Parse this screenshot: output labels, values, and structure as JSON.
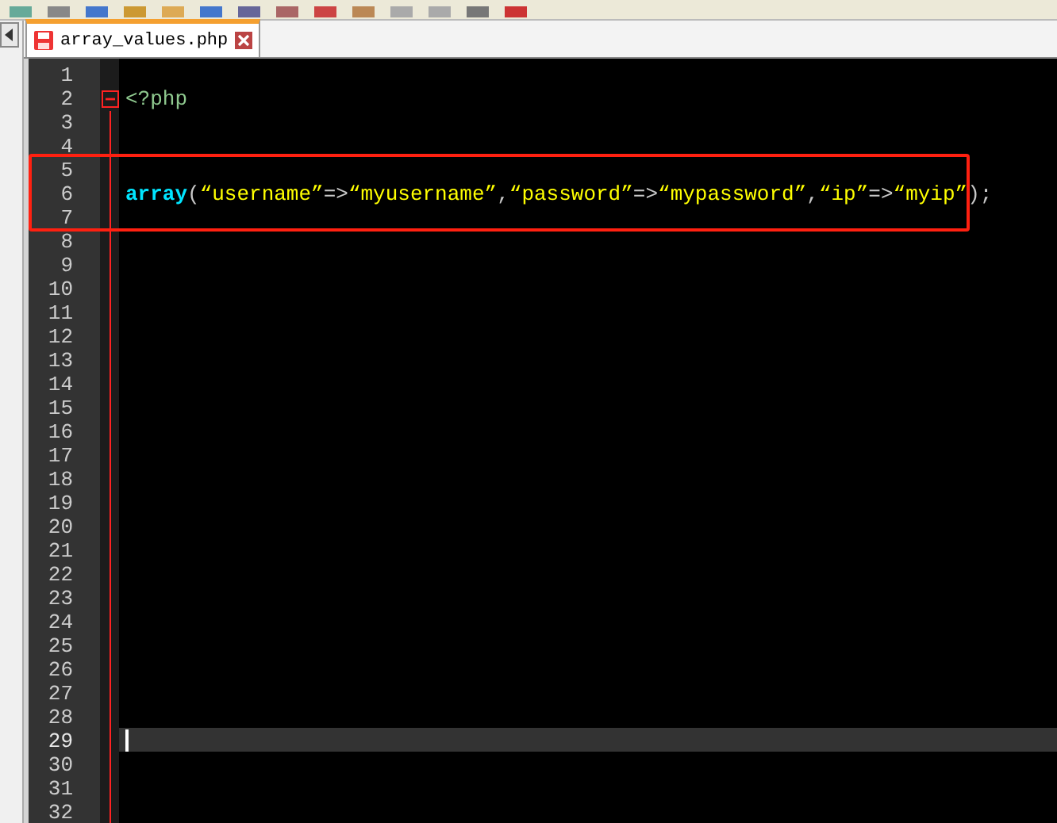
{
  "tabs": [
    {
      "label": "array_values.php",
      "selected": true
    }
  ],
  "editor": {
    "lines": [
      {
        "number": "1",
        "kind": "plain",
        "current": false
      },
      {
        "number": "2",
        "kind": "fold-start",
        "current": false,
        "tokens": [
          {
            "kind": "tag",
            "text": "<?php"
          }
        ]
      },
      {
        "number": "3",
        "kind": "plain",
        "current": false
      },
      {
        "number": "4",
        "kind": "plain",
        "current": false
      },
      {
        "number": "5",
        "kind": "plain",
        "current": false
      },
      {
        "number": "6",
        "kind": "plain",
        "current": false,
        "tokens": [
          {
            "kind": "keyword",
            "text": "array"
          },
          {
            "kind": "punct",
            "text": "("
          },
          {
            "kind": "string",
            "text": "“username”"
          },
          {
            "kind": "punct",
            "text": "=>"
          },
          {
            "kind": "string",
            "text": "“myusername”"
          },
          {
            "kind": "punct",
            "text": ","
          },
          {
            "kind": "string",
            "text": "“password”"
          },
          {
            "kind": "punct",
            "text": "=>"
          },
          {
            "kind": "string",
            "text": "“mypassword”"
          },
          {
            "kind": "punct",
            "text": ","
          },
          {
            "kind": "string",
            "text": "“ip”"
          },
          {
            "kind": "punct",
            "text": "=>"
          },
          {
            "kind": "string",
            "text": "“myip”"
          },
          {
            "kind": "punct",
            "text": ");"
          }
        ]
      },
      {
        "number": "7",
        "kind": "plain",
        "current": false
      },
      {
        "number": "8",
        "kind": "plain",
        "current": false
      },
      {
        "number": "9",
        "kind": "plain",
        "current": false
      },
      {
        "number": "10",
        "kind": "plain",
        "current": false
      },
      {
        "number": "11",
        "kind": "plain",
        "current": false
      },
      {
        "number": "12",
        "kind": "plain",
        "current": false
      },
      {
        "number": "13",
        "kind": "plain",
        "current": false
      },
      {
        "number": "14",
        "kind": "plain",
        "current": false
      },
      {
        "number": "15",
        "kind": "plain",
        "current": false
      },
      {
        "number": "16",
        "kind": "plain",
        "current": false
      },
      {
        "number": "17",
        "kind": "plain",
        "current": false
      },
      {
        "number": "18",
        "kind": "plain",
        "current": false
      },
      {
        "number": "19",
        "kind": "plain",
        "current": false
      },
      {
        "number": "20",
        "kind": "plain",
        "current": false
      },
      {
        "number": "21",
        "kind": "plain",
        "current": false
      },
      {
        "number": "22",
        "kind": "plain",
        "current": false
      },
      {
        "number": "23",
        "kind": "plain",
        "current": false
      },
      {
        "number": "24",
        "kind": "plain",
        "current": false
      },
      {
        "number": "25",
        "kind": "plain",
        "current": false
      },
      {
        "number": "26",
        "kind": "plain",
        "current": false
      },
      {
        "number": "27",
        "kind": "plain",
        "current": false
      },
      {
        "number": "28",
        "kind": "plain",
        "current": false
      },
      {
        "number": "29",
        "kind": "plain",
        "current": true
      },
      {
        "number": "30",
        "kind": "plain",
        "current": false
      },
      {
        "number": "31",
        "kind": "plain",
        "current": false
      },
      {
        "number": "32",
        "kind": "plain",
        "current": false
      }
    ]
  }
}
